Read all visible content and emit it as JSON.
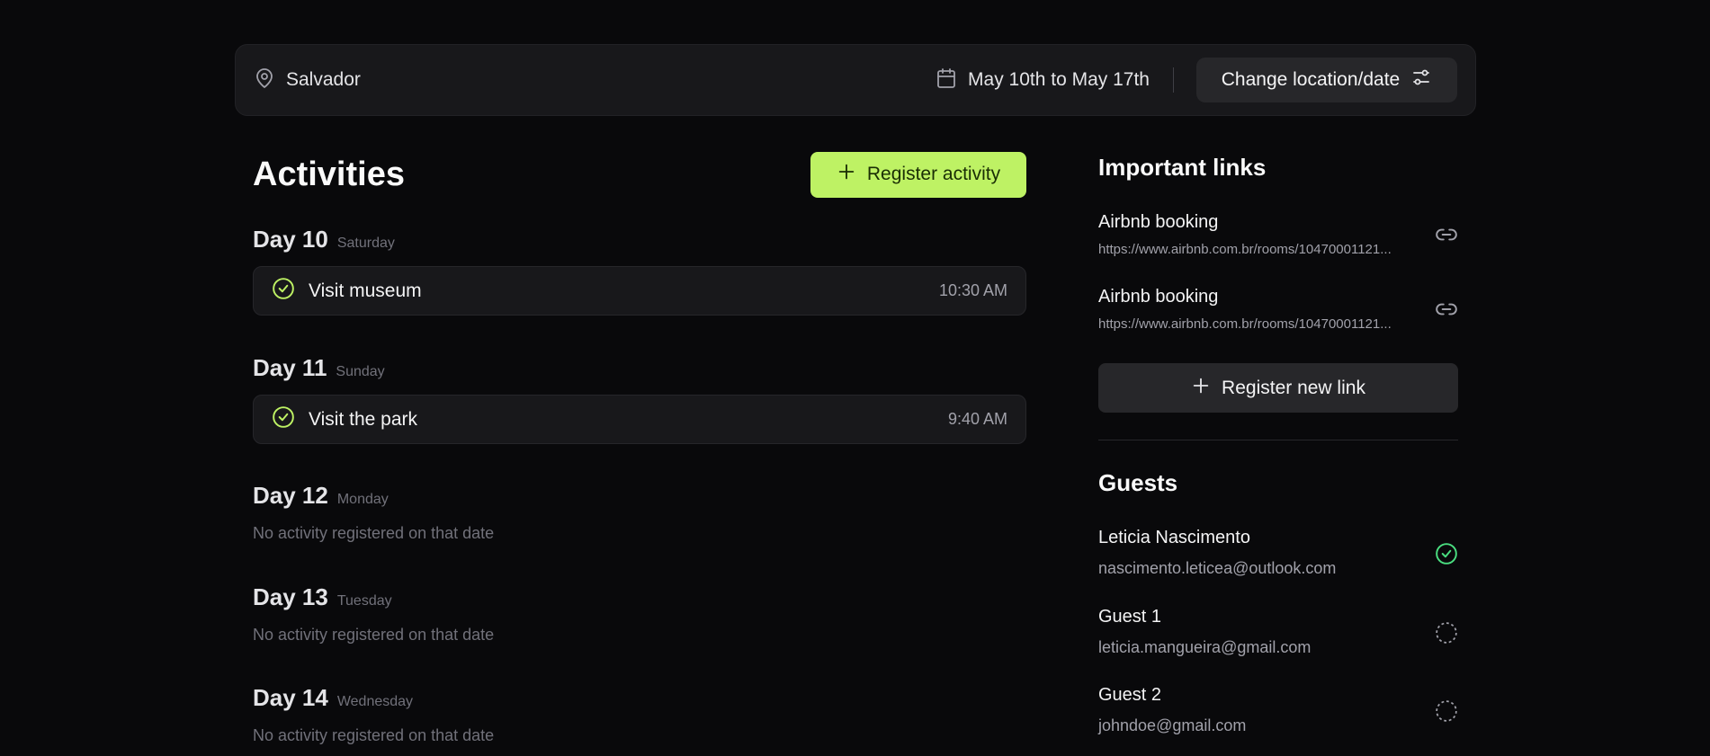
{
  "header": {
    "location": "Salvador",
    "date_range": "May 10th to May 17th",
    "change_button": "Change location/date"
  },
  "activities": {
    "title": "Activities",
    "register_button": "Register activity",
    "days": [
      {
        "num": "Day 10",
        "name": "Saturday",
        "items": [
          {
            "title": "Visit museum",
            "time": "10:30 AM"
          }
        ]
      },
      {
        "num": "Day 11",
        "name": "Sunday",
        "items": [
          {
            "title": "Visit the park",
            "time": "9:40 AM"
          }
        ]
      },
      {
        "num": "Day 12",
        "name": "Monday",
        "empty": "No activity registered on that date"
      },
      {
        "num": "Day 13",
        "name": "Tuesday",
        "empty": "No activity registered on that date"
      },
      {
        "num": "Day 14",
        "name": "Wednesday",
        "empty": "No activity registered on that date"
      }
    ]
  },
  "links": {
    "title": "Important links",
    "items": [
      {
        "title": "Airbnb booking",
        "url": "https://www.airbnb.com.br/rooms/10470001121..."
      },
      {
        "title": "Airbnb booking",
        "url": "https://www.airbnb.com.br/rooms/10470001121..."
      }
    ],
    "register_button": "Register new link"
  },
  "guests": {
    "title": "Guests",
    "items": [
      {
        "name": "Leticia Nascimento",
        "email": "nascimento.leticea@outlook.com",
        "status": "confirmed"
      },
      {
        "name": "Guest 1",
        "email": "leticia.mangueira@gmail.com",
        "status": "pending"
      },
      {
        "name": "Guest 2",
        "email": "johndoe@gmail.com",
        "status": "pending"
      }
    ]
  },
  "colors": {
    "accent": "#bef264",
    "confirmed": "#4ade80",
    "background": "#09090b",
    "card": "#18181b"
  }
}
